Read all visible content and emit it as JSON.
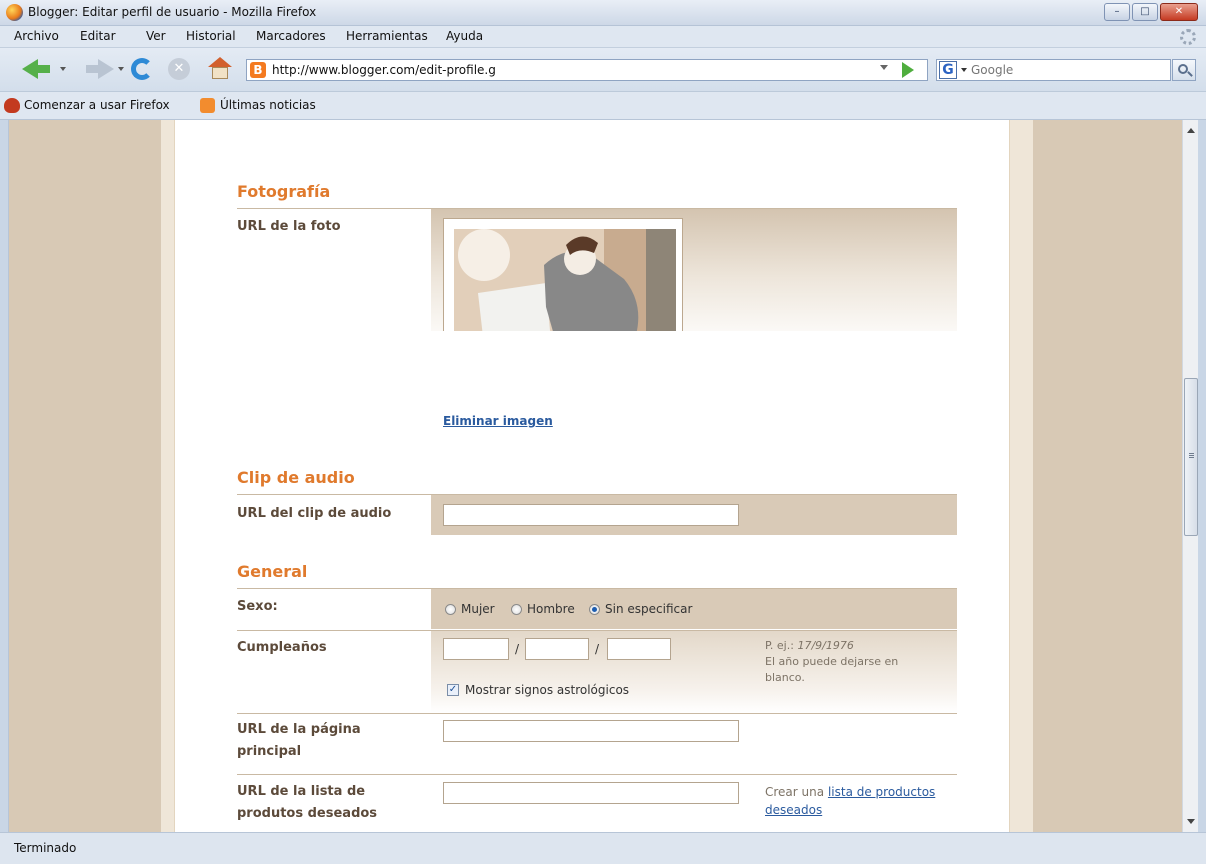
{
  "window": {
    "title": "Blogger: Editar perfil de usuario - Mozilla Firefox",
    "controls": [
      "minimize",
      "maximize",
      "close"
    ]
  },
  "menu": {
    "items": [
      "Archivo",
      "Editar",
      "Ver",
      "Historial",
      "Marcadores",
      "Herramientas",
      "Ayuda"
    ]
  },
  "navigation": {
    "url": "http://www.blogger.com/edit-profile.g",
    "search_placeholder": "Google"
  },
  "bookmarks": {
    "items": [
      "Comenzar a usar Firefox",
      "Últimas noticias"
    ]
  },
  "sections": {
    "photo": {
      "title": "Fotografía",
      "url_label": "URL de la foto",
      "remove_link": "Eliminar imagen"
    },
    "audio": {
      "title": "Clip de audio",
      "url_label": "URL del clip de audio",
      "url_value": ""
    },
    "general": {
      "title": "General",
      "sex_label": "Sexo:",
      "sex_options": [
        "Mujer",
        "Hombre",
        "Sin especificar"
      ],
      "sex_selected": "Sin especificar",
      "birthday_label": "Cumpleaños",
      "birthday_separator": "/",
      "birthday_hint_prefix": "P. ej.:",
      "birthday_hint_example": "17/9/1976",
      "birthday_hint_note": "El año puede dejarse en blanco.",
      "astro_label": "Mostrar signos astrológicos",
      "astro_checked": true,
      "homepage_label": "URL de la página principal",
      "wishlist_label": "URL de la lista de produtos deseados",
      "wishlist_hint_prefix": "Crear una",
      "wishlist_hint_link": "lista de productos deseados"
    }
  },
  "status": {
    "text": "Terminado"
  },
  "colors": {
    "section_title": "#e07a2d",
    "label": "#5c4a3a",
    "link": "#2a5a9e",
    "field_band": "#d9cab7",
    "side_background": "#d8c9b5"
  }
}
